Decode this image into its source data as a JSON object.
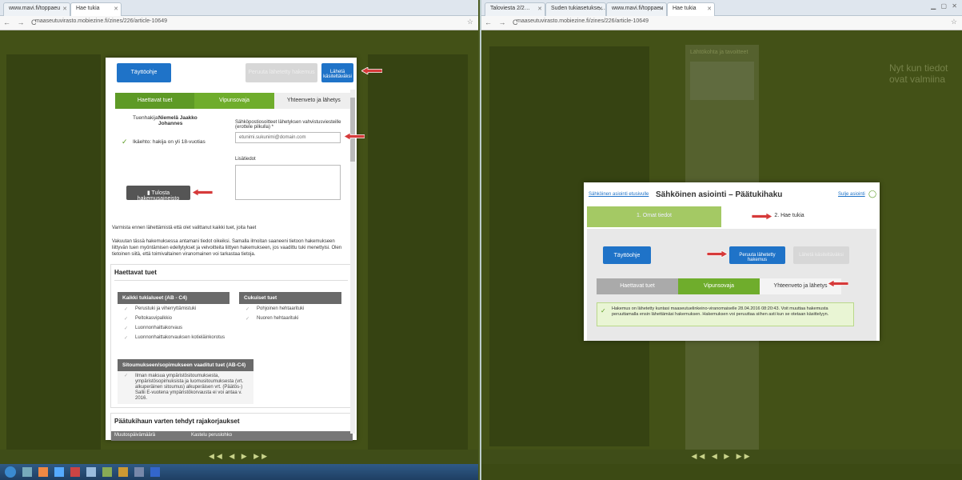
{
  "left": {
    "tabs": [
      {
        "label": "www.mavi.fi/toppaeu"
      },
      {
        "label": "Hae tukia"
      }
    ],
    "url": "maaseutuvirasto.mobiezine.fi/zines/226/article-10649",
    "buttons": {
      "taytto": "Täyttöohje",
      "peruuta": "Peruuta lähetetty hakemus",
      "laheta": "Lähetä käsiteltäväksi",
      "tulosta": "Tulosta hakemusaineisto"
    },
    "steps": [
      "Haettavat tuet",
      "Vipunsovaja",
      "Yhteenveto ja lähetys"
    ],
    "applicant_label": "Tuenhakija:",
    "applicant_name": "Niemelä Jaakko Johannes",
    "age_check": "Ikäehto: hakija on yli 18-vuotias",
    "email_label": "Sähköpostiosoitteet lähetyksen vahvistusviesteille (erottele pilkulla) *",
    "email_value": "etunimi.sukunimi@domain.com",
    "notes_label": "Lisätiedot",
    "confirm_text": "Varmista ennen lähettämistä että olet valittanut kaikki tuet, joita haet",
    "info_text": "Vakuutan tässä hakemuksessa antamani tiedot oikeiksi. Samalla ilmoitan saaneeni tietoon hakemukseen liittyvän tuen myöntämisen edellytykset ja velvoitteita liittyen hakemukseen, jos vaadittu tuki menettyisi. Olen tietoinen siitä, että toimivaltainen viranomainen voi tarkastaa tietoja.",
    "haettavat_title": "Haettavat tuet",
    "table1_head": "Kaikki tukialueet (AB - C4)",
    "table1_rows": [
      "Perustuki ja viherryttämistuki",
      "Peltokasvipalkkio",
      "Luonnonhaittakorvaus",
      "Luonnonhaittakorvauksen kotieläinkorotus"
    ],
    "table2_head": "Cukuiset tuet",
    "table2_rows": [
      "Pohjoinen hehtaarituki",
      "Nuoren hehtaarituki"
    ],
    "table3_head": "Sitoumukseen/sopimukseen vaaditut tuet (AB-C4)",
    "table3_row": "Ilman maksua ympäristösitoumuksesta, ympäristösopimuksista ja luomusitoumuksesta (vrt. alkuperäinen sitoumus) alkuperäisen vrt. (Päätös-) Sallii E-vuotena ympäristökorvausta ei voi antaa v. 2016.",
    "paatoshaku_title": "Päätukihaun varten tehdyt rajakorjaukset",
    "col_a": "Muutospäivämäärä",
    "col_b": "Kastelu peruslohko",
    "player_controls": "◀◀ ◀ ▶ ▶▶"
  },
  "right": {
    "tabs": [
      {
        "label": "Taloviesta 2/2…"
      },
      {
        "label": "Suden tukiasetukse…"
      },
      {
        "label": "www.mavi.fi/toppaeu"
      },
      {
        "label": "Hae tukia"
      }
    ],
    "url": "maaseutuvirasto.mobiezine.fi/zines/226/article-10649",
    "bg_title": "Lähtökohta ja tavoitteet",
    "bg_side": "Nyt kun tiedot ovat valmiina",
    "dialog": {
      "back_link": "Sähköinen asiointi etusivulle",
      "title": "Sähköinen asiointi – Päätukihaku",
      "exit_link": "Sulje asiointi",
      "step1": "1. Omat tiedot",
      "step2": "2. Hae tukia",
      "taytto": "Täyttöohje",
      "peruuta": "Peruuta lähetetty hakemus",
      "laheta": "Lähetä käsiteltäväksi",
      "substeps": [
        "Haettavat tuet",
        "Vipunsovaja",
        "Yhteenveto ja lähetys"
      ],
      "success": "Hakemus on lähetetty kuntasi maaseutuelinkeino-viranomaiselle 28.04.2016 08:20:43. Voit muuttaa hakemusta peruuttamalla ensin lähettämäsi hakemuksen. Hakemuksen voi peruuttaa siihen asti kun se otetaan käsittelyyn."
    },
    "player_controls": "◀◀ ◀ ▶ ▶▶"
  },
  "colors": {
    "accent_green": "#5e9a26",
    "button_blue": "#1f73c8",
    "arrow_red": "#d63a3a",
    "bg_olive": "#5a6b22"
  }
}
